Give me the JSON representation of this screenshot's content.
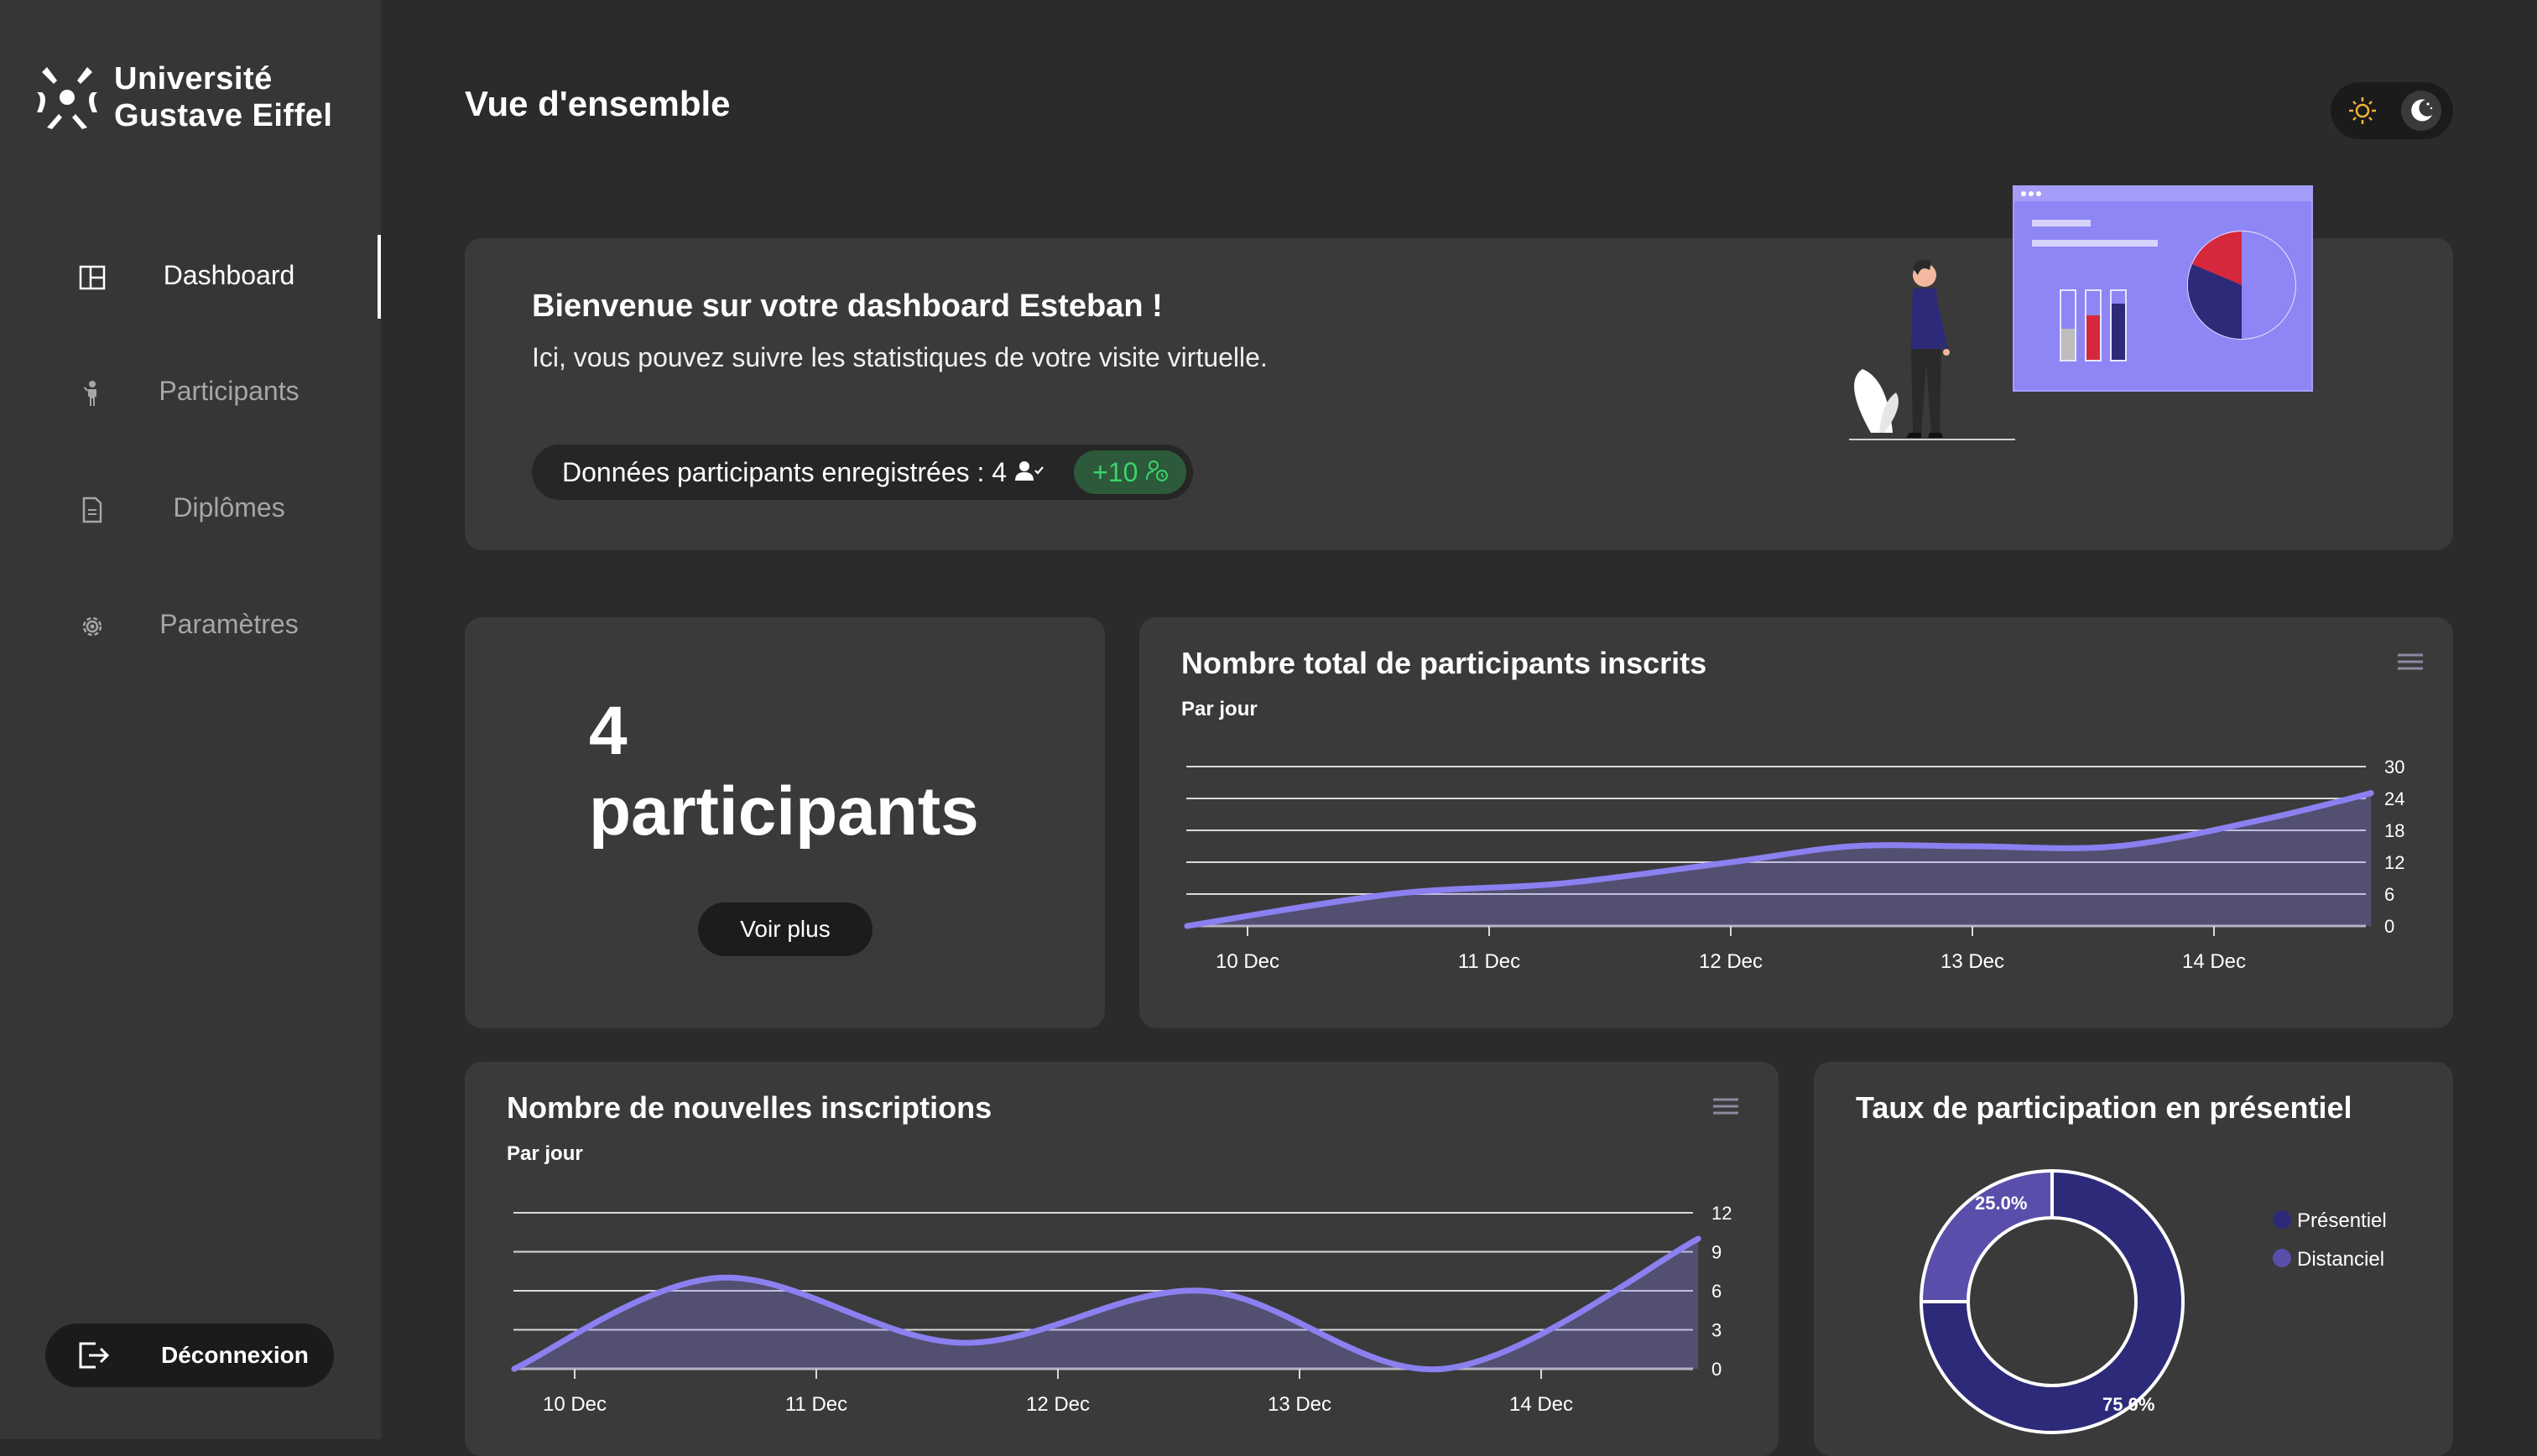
{
  "brand": {
    "line1": "Université",
    "line2": "Gustave Eiffel"
  },
  "sidebar": {
    "items": [
      {
        "label": "Dashboard",
        "icon": "layout-icon",
        "active": true
      },
      {
        "label": "Participants",
        "icon": "person-icon",
        "active": false
      },
      {
        "label": "Diplômes",
        "icon": "document-icon",
        "active": false
      },
      {
        "label": "Paramètres",
        "icon": "gear-icon",
        "active": false
      }
    ],
    "logout_label": "Déconnexion"
  },
  "header": {
    "title": "Vue d'ensemble"
  },
  "welcome": {
    "title": "Bienvenue sur votre dashboard Esteban !",
    "subtitle": "Ici, vous pouvez suivre les statistiques de votre visite virtuelle.",
    "stat_label": "Données participants enregistrées : 4",
    "delta": "+10"
  },
  "participants_card": {
    "count": "4",
    "label": "participants",
    "button": "Voir plus"
  },
  "colors": {
    "accent": "#8b80f0",
    "donut_presentiel": "#2e2a7a",
    "donut_distanciel": "#5a4eab",
    "delta_green": "#3ad46a"
  },
  "chart_data": [
    {
      "type": "area",
      "title": "Nombre total de participants inscrits",
      "subtitle": "Par jour",
      "x": [
        "10 Dec",
        "11 Dec",
        "12 Dec",
        "13 Dec",
        "14 Dec"
      ],
      "y_ticks": [
        0,
        6,
        12,
        18,
        24,
        30
      ],
      "ylim": [
        0,
        30
      ],
      "series": [
        {
          "points": [
            [
              -0.25,
              0
            ],
            [
              0.6,
              6
            ],
            [
              1.3,
              8
            ],
            [
              2.0,
              12
            ],
            [
              2.5,
              15
            ],
            [
              3.0,
              15
            ],
            [
              3.6,
              15
            ],
            [
              4.2,
              20
            ],
            [
              4.65,
              25
            ]
          ]
        }
      ],
      "axis_side": "right"
    },
    {
      "type": "area",
      "title": "Nombre de nouvelles inscriptions",
      "subtitle": "Par jour",
      "x": [
        "10 Dec",
        "11 Dec",
        "12 Dec",
        "13 Dec",
        "14 Dec"
      ],
      "y_ticks": [
        0,
        3,
        6,
        9,
        12
      ],
      "ylim": [
        0,
        12
      ],
      "series": [
        {
          "points": [
            [
              -0.25,
              0
            ],
            [
              0.6,
              7
            ],
            [
              1.6,
              2
            ],
            [
              2.6,
              6
            ],
            [
              3.6,
              0
            ],
            [
              4.65,
              10
            ]
          ]
        }
      ],
      "axis_side": "right"
    },
    {
      "type": "pie",
      "title": "Taux de participation en présentiel",
      "slices": [
        {
          "name": "Présentiel",
          "value": 75,
          "label": "75.0%"
        },
        {
          "name": "Distanciel",
          "value": 25,
          "label": "25.0%"
        }
      ]
    }
  ]
}
